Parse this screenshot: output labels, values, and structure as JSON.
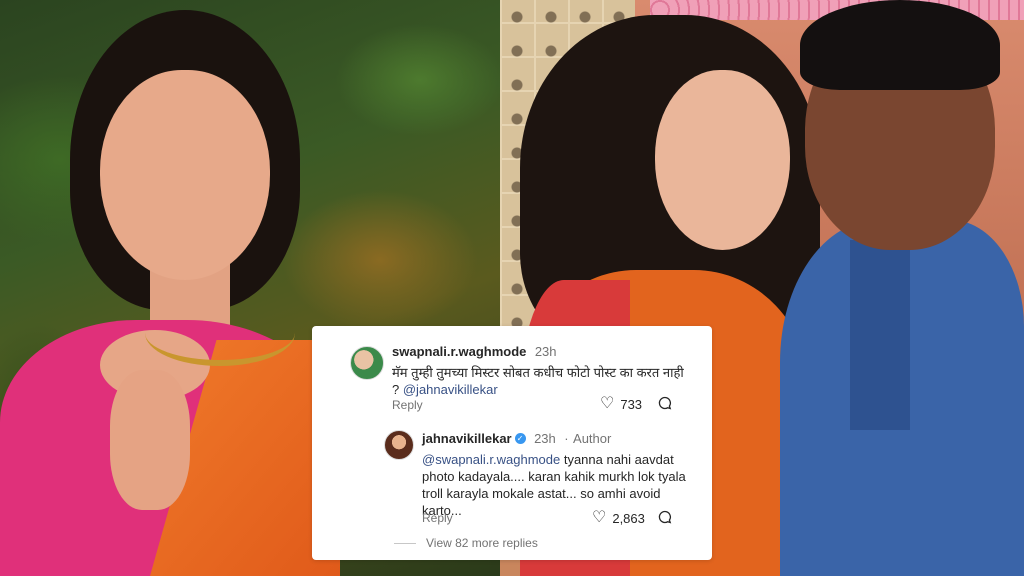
{
  "comment1": {
    "username": "swapnali.r.waghmode",
    "time": "23h",
    "text": "मॅम तुम्ही तुमच्या मिस्टर सोबत कधीच फोटो पोस्ट का करत नाही ?",
    "mention": "@jahnavikillekar",
    "reply_label": "Reply",
    "likes": "733",
    "avatar_icon": "user-avatar"
  },
  "comment2": {
    "username": "jahnavikillekar",
    "time": "23h",
    "author_label": "Author",
    "mention": "@swapnali.r.waghmode",
    "text": " tyanna nahi aavdat photo kadayala.... karan kahik murkh lok tyala troll karayla mokale astat... so amhi avoid karto...",
    "reply_label": "Reply",
    "likes": "2,863",
    "avatar_icon": "user-avatar"
  },
  "view_more_replies": "View 82 more replies",
  "icons": {
    "heart": "heart-icon",
    "comment": "comment-bubble-icon",
    "verified": "verified-badge-icon"
  },
  "colors": {
    "mention": "#385185",
    "card_bg": "#ffffff",
    "verified": "#3897f0"
  }
}
